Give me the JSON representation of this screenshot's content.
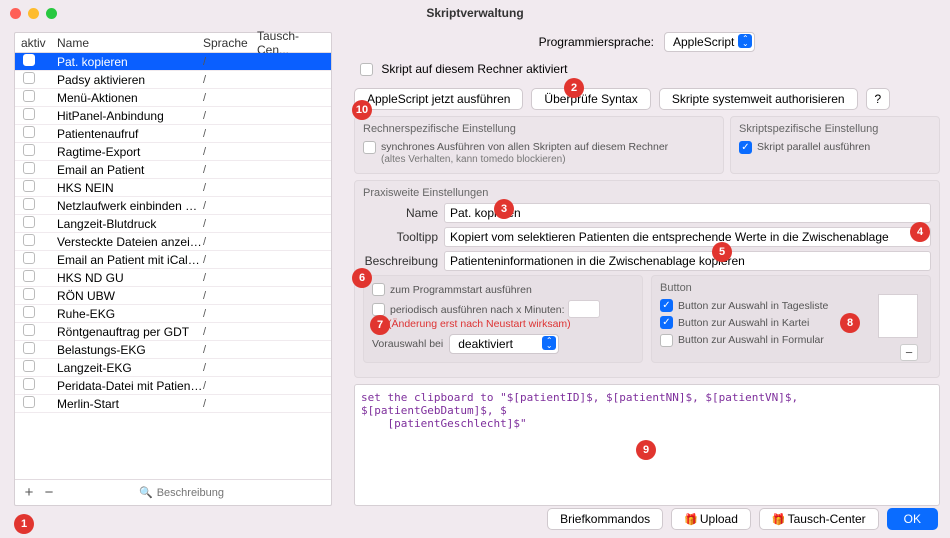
{
  "window_title": "Skriptverwaltung",
  "columns": {
    "aktiv": "aktiv",
    "name": "Name",
    "sprache": "Sprache",
    "tausch": "Tausch-Cen..."
  },
  "scripts": [
    {
      "name": "Pat. kopieren",
      "sprache": "/",
      "selected": true
    },
    {
      "name": "Padsy aktivieren",
      "sprache": "/"
    },
    {
      "name": "Menü-Aktionen",
      "sprache": "/"
    },
    {
      "name": "HitPanel-Anbindung",
      "sprache": "/"
    },
    {
      "name": "Patientenaufruf",
      "sprache": "/"
    },
    {
      "name": "Ragtime-Export",
      "sprache": "/"
    },
    {
      "name": "Email an Patient",
      "sprache": "/"
    },
    {
      "name": "HKS NEIN",
      "sprache": "/"
    },
    {
      "name": "Netzlaufwerk einbinden neu",
      "sprache": "/"
    },
    {
      "name": "Langzeit-Blutdruck",
      "sprache": "/"
    },
    {
      "name": "Versteckte Dateien anzeigen",
      "sprache": "/"
    },
    {
      "name": "Email an Patient mit iCal-Anha...",
      "sprache": "/"
    },
    {
      "name": "HKS ND GU",
      "sprache": "/"
    },
    {
      "name": "RÖN UBW",
      "sprache": "/"
    },
    {
      "name": "Ruhe-EKG",
      "sprache": "/"
    },
    {
      "name": "Röntgenauftrag per GDT",
      "sprache": "/"
    },
    {
      "name": "Belastungs-EKG",
      "sprache": "/"
    },
    {
      "name": "Langzeit-EKG",
      "sprache": "/"
    },
    {
      "name": "Peridata-Datei mit PatientID",
      "sprache": "/"
    },
    {
      "name": "Merlin-Start",
      "sprache": "/"
    }
  ],
  "search_placeholder": "Beschreibung",
  "labels": {
    "prog_lang": "Programmiersprache:",
    "lang_value": "AppleScript",
    "activate": "Skript auf diesem Rechner aktiviert",
    "run_now": "AppleScript jetzt ausführen",
    "check_syntax": "Überprüfe Syntax",
    "sys_auth": "Skripte systemweit authorisieren",
    "rechner_title": "Rechnerspezifische Einstellung",
    "sync_exec": "synchrones Ausführen von allen Skripten auf diesem Rechner",
    "sync_note": "(altes Verhalten, kann tomedo blockieren)",
    "script_title": "Skriptspezifische Einstellung",
    "parallel": "Skript parallel ausführen",
    "praxis_title": "Praxisweite Einstellungen",
    "name": "Name",
    "tooltip": "Tooltipp",
    "desc": "Beschreibung",
    "on_start": "zum Programmstart ausführen",
    "periodic": "periodisch ausführen nach x Minuten:",
    "restart_note": "(Änderung erst nach Neustart wirksam)",
    "preselect": "Vorauswahl bei",
    "preselect_val": "deaktiviert",
    "button_title": "Button",
    "btn_tagesliste": "Button zur Auswahl in Tagesliste",
    "btn_kartei": "Button zur Auswahl in Kartei",
    "btn_formular": "Button zur Auswahl in Formular"
  },
  "form": {
    "name": "Pat. kopieren",
    "tooltip": "Kopiert vom selektieren Patienten die entsprechende Werte in die Zwischenablage",
    "desc": "Patienteninformationen in die Zwischenablage kopieren"
  },
  "code": "set the clipboard to \"$[patientID]$, $[patientNN]$, $[patientVN]$, $[patientGebDatum]$, $\n    [patientGeschlecht]$\"",
  "footer": {
    "briefkommandos": "Briefkommandos",
    "upload": "Upload",
    "tausch": "Tausch-Center",
    "ok": "OK"
  },
  "badges": [
    "1",
    "2",
    "3",
    "4",
    "5",
    "6",
    "7",
    "8",
    "9",
    "10"
  ]
}
